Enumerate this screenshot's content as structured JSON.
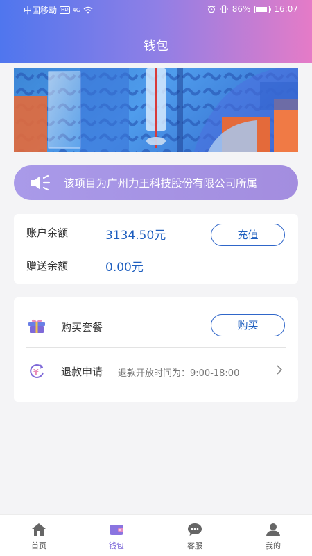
{
  "status_bar": {
    "carrier": "中国移动",
    "hd": "HD",
    "network": "4G",
    "battery": "86%",
    "battery_level": 0.86,
    "time": "16:07"
  },
  "header": {
    "title": "钱包"
  },
  "notice": {
    "text": "该项目为广州力王科技股份有限公司所属"
  },
  "balance": {
    "account_label": "账户余额",
    "account_value": "3134.50元",
    "gift_label": "赠送余额",
    "gift_value": "0.00元",
    "recharge_button": "充值"
  },
  "actions": {
    "package_label": "购买套餐",
    "buy_button": "购买",
    "refund_label": "退款申请",
    "refund_hint": "退款开放时间为：9:00-18:00"
  },
  "tabbar": {
    "items": [
      {
        "label": "首页",
        "icon": "home-icon"
      },
      {
        "label": "钱包",
        "icon": "wallet-icon"
      },
      {
        "label": "客服",
        "icon": "chat-icon"
      },
      {
        "label": "我的",
        "icon": "user-icon"
      }
    ],
    "active": 1
  },
  "colors": {
    "primary": "#2f66c9",
    "accent": "#7b66d8",
    "notice_bg": "#a99ae9"
  }
}
